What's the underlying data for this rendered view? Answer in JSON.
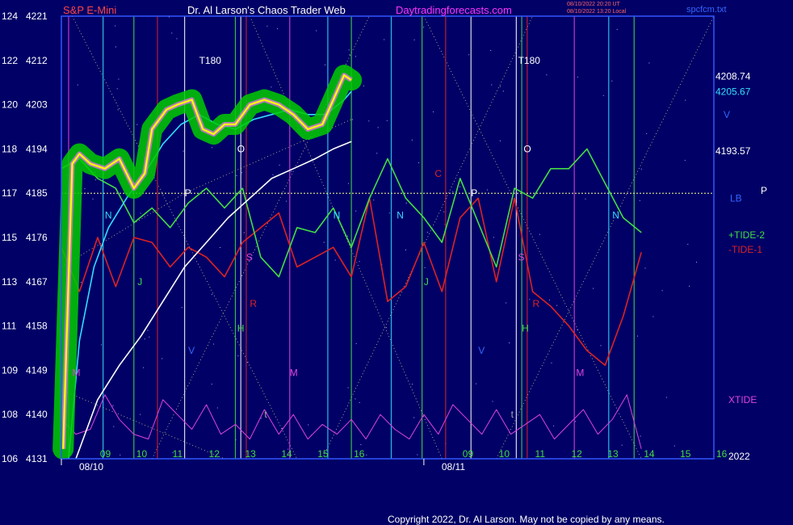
{
  "header": {
    "instrument": "S&P E-Mini",
    "author": "Dr. Al Larson's Chaos Trader Web",
    "site": "Daytradingforecasts.com",
    "timestamp_1": "08/10/2022 20:20 UT",
    "timestamp_2": "08/10/2022 13:20 Local",
    "filename": "spcfcm.txt"
  },
  "footer": {
    "copyright": "Copyright 2022, Dr. Al Larson. May not be copied by any means."
  },
  "colors": {
    "background": "#000066",
    "plot_border": "#3355ff",
    "price": "#ffff00",
    "price_halo": "#00cc00",
    "price_inner": "#ff66ff",
    "avg_fast": "#33ddff",
    "avg_slow": "#ffffff",
    "tide_2": "#44dd44",
    "tide_1": "#dd2222",
    "xtide": "#dd44dd",
    "blue_line": "#2233ee"
  },
  "chart_data": {
    "type": "line",
    "x_axis": {
      "days": [
        {
          "label": "08/10",
          "x": 0
        },
        {
          "label": "08/11",
          "x": 10
        }
      ],
      "hours": [
        {
          "label": "09",
          "x": 1
        },
        {
          "label": "10",
          "x": 2
        },
        {
          "label": "11",
          "x": 3
        },
        {
          "label": "12",
          "x": 4
        },
        {
          "label": "13",
          "x": 5
        },
        {
          "label": "14",
          "x": 6
        },
        {
          "label": "15",
          "x": 7
        },
        {
          "label": "16",
          "x": 8
        },
        {
          "label": "09",
          "x": 11
        },
        {
          "label": "10",
          "x": 12
        },
        {
          "label": "11",
          "x": 13
        },
        {
          "label": "12",
          "x": 14
        },
        {
          "label": "13",
          "x": 15
        },
        {
          "label": "14",
          "x": 16
        },
        {
          "label": "15",
          "x": 17
        },
        {
          "label": "16",
          "x": 18
        }
      ],
      "xlim": [
        0,
        18
      ]
    },
    "y_axis": {
      "ticks": [
        {
          "left": "106",
          "right": "4131",
          "y": 4131
        },
        {
          "left": "108",
          "right": "4140",
          "y": 4140
        },
        {
          "left": "109",
          "right": "4149",
          "y": 4149
        },
        {
          "left": "111",
          "right": "4158",
          "y": 4158
        },
        {
          "left": "113",
          "right": "4167",
          "y": 4167
        },
        {
          "left": "115",
          "right": "4176",
          "y": 4176
        },
        {
          "left": "117",
          "right": "4185",
          "y": 4185
        },
        {
          "left": "118",
          "right": "4194",
          "y": 4194
        },
        {
          "left": "120",
          "right": "4203",
          "y": 4203
        },
        {
          "left": "122",
          "right": "4212",
          "y": 4212
        },
        {
          "left": "124",
          "right": "4221",
          "y": 4221
        }
      ],
      "ylim": [
        4131,
        4221
      ]
    },
    "right_labels": [
      {
        "text": "4208.74",
        "y": 4208.74,
        "color": "#ffffff"
      },
      {
        "text": "4205.67",
        "y": 4205.67,
        "color": "#33ddff"
      },
      {
        "text": "4193.57",
        "y": 4193.57,
        "color": "#ffffff"
      }
    ],
    "right_legend": [
      {
        "text": "V",
        "y": 4201,
        "color": "#3366ff"
      },
      {
        "text": "LB",
        "y": 4184,
        "color": "#3366ff"
      },
      {
        "text": "P",
        "y": 4185.5,
        "color": "#ffffff",
        "offset": 1
      },
      {
        "text": "+TIDE-2",
        "y": 4176.5,
        "color": "#44dd44"
      },
      {
        "text": "-TIDE-1",
        "y": 4173.5,
        "color": "#dd2222"
      },
      {
        "text": "XTIDE",
        "y": 4143,
        "color": "#dd44dd"
      },
      {
        "text": "2022",
        "y": 4131.5,
        "color": "#ffffff"
      }
    ],
    "markers": [
      {
        "text": "T180",
        "x": 3.8,
        "y": 4212,
        "color": "#ffffff"
      },
      {
        "text": "T180",
        "x": 12.6,
        "y": 4212,
        "color": "#ffffff"
      },
      {
        "text": "O",
        "x": 4.85,
        "y": 4194,
        "color": "#ffffff"
      },
      {
        "text": "O",
        "x": 12.75,
        "y": 4194,
        "color": "#ffffff"
      },
      {
        "text": "P",
        "x": 3.4,
        "y": 4185,
        "color": "#ffffff"
      },
      {
        "text": "P",
        "x": 11.3,
        "y": 4185,
        "color": "#ffffff"
      },
      {
        "text": "N",
        "x": 1.2,
        "y": 4180.5,
        "color": "#33ddff"
      },
      {
        "text": "N",
        "x": 7.5,
        "y": 4180.5,
        "color": "#33ddff"
      },
      {
        "text": "N",
        "x": 9.25,
        "y": 4180.5,
        "color": "#33ddff"
      },
      {
        "text": "N",
        "x": 15.2,
        "y": 4180.5,
        "color": "#33ddff"
      },
      {
        "text": "C",
        "x": 10.3,
        "y": 4189,
        "color": "#dd2222"
      },
      {
        "text": "S",
        "x": 5.1,
        "y": 4172,
        "color": "#dd44dd"
      },
      {
        "text": "S",
        "x": 12.6,
        "y": 4172,
        "color": "#dd44dd"
      },
      {
        "text": "J",
        "x": 2.1,
        "y": 4167,
        "color": "#44dd44"
      },
      {
        "text": "J",
        "x": 10,
        "y": 4167,
        "color": "#44dd44"
      },
      {
        "text": "R",
        "x": 5.2,
        "y": 4162.5,
        "color": "#dd2222"
      },
      {
        "text": "R",
        "x": 13,
        "y": 4162.5,
        "color": "#dd2222"
      },
      {
        "text": "H",
        "x": 4.85,
        "y": 4157.5,
        "color": "#44dd44"
      },
      {
        "text": "H",
        "x": 12.7,
        "y": 4157.5,
        "color": "#44dd44"
      },
      {
        "text": "V",
        "x": 3.5,
        "y": 4153,
        "color": "#3366ff"
      },
      {
        "text": "V",
        "x": 11.5,
        "y": 4153,
        "color": "#3366ff"
      },
      {
        "text": "M",
        "x": 0.3,
        "y": 4148.5,
        "color": "#dd44dd"
      },
      {
        "text": "M",
        "x": 6.3,
        "y": 4148.5,
        "color": "#dd44dd"
      },
      {
        "text": "M",
        "x": 14.2,
        "y": 4148.5,
        "color": "#dd44dd"
      },
      {
        "text": "t",
        "x": 5.6,
        "y": 4140,
        "color": "#aaaaaa"
      },
      {
        "text": "t",
        "x": 12.4,
        "y": 4140,
        "color": "#aaaaaa"
      }
    ],
    "vertical_lines": [
      {
        "x": 0.2,
        "color": "#dd44dd"
      },
      {
        "x": 1.15,
        "color": "#33ddff"
      },
      {
        "x": 2.0,
        "color": "#44dd44"
      },
      {
        "x": 2.65,
        "color": "#dd2222"
      },
      {
        "x": 3.4,
        "color": "#ffffff"
      },
      {
        "x": 4.8,
        "color": "#44dd44"
      },
      {
        "x": 4.95,
        "color": "#ffffff"
      },
      {
        "x": 5.1,
        "color": "#dd2222"
      },
      {
        "x": 6.3,
        "color": "#dd44dd"
      },
      {
        "x": 7.35,
        "color": "#33ddff"
      },
      {
        "x": 8.0,
        "color": "#44dd44"
      },
      {
        "x": 9.1,
        "color": "#33ddff"
      },
      {
        "x": 9.95,
        "color": "#44dd44"
      },
      {
        "x": 10.6,
        "color": "#dd2222"
      },
      {
        "x": 11.3,
        "color": "#ffffff"
      },
      {
        "x": 12.55,
        "color": "#ffffff"
      },
      {
        "x": 12.7,
        "color": "#44dd44"
      },
      {
        "x": 12.85,
        "color": "#dd2222"
      },
      {
        "x": 14.15,
        "color": "#dd44dd"
      },
      {
        "x": 15.1,
        "color": "#33ddff"
      },
      {
        "x": 15.8,
        "color": "#44dd44"
      }
    ],
    "horizontal_lines": [
      {
        "y": 4185,
        "color": "#ffff88",
        "dashed": true
      }
    ],
    "series": [
      {
        "name": "S&P E-Mini",
        "color": "#ffff00",
        "x": [
          0.05,
          0.2,
          0.3,
          0.5,
          0.8,
          1.2,
          1.6,
          2.0,
          2.3,
          2.5,
          2.9,
          3.2,
          3.6,
          3.9,
          4.2,
          4.5,
          4.8,
          5.2,
          5.6,
          6.0,
          6.4,
          6.8,
          7.2,
          7.5,
          7.8,
          8.0
        ],
        "y": [
          4133,
          4168,
          4191,
          4193,
          4191,
          4190,
          4192,
          4186,
          4189,
          4198,
          4202,
          4203,
          4204,
          4198,
          4197,
          4199,
          4199,
          4203,
          4204,
          4203,
          4201,
          4198,
          4199,
          4204,
          4209,
          4208
        ]
      },
      {
        "name": "fast average",
        "color": "#33ddff",
        "x": [
          0.2,
          0.5,
          0.9,
          1.3,
          1.8,
          2.3,
          2.8,
          3.3,
          3.8,
          4.3,
          4.8,
          5.3,
          5.8,
          6.3,
          6.8,
          7.3,
          7.8,
          8.0
        ],
        "y": [
          4131,
          4155,
          4170,
          4178,
          4184,
          4189,
          4195,
          4199,
          4201,
          4199,
          4198,
          4200,
          4201,
          4202,
          4201,
          4201,
          4204,
          4205.7
        ]
      },
      {
        "name": "slow average",
        "color": "#ffffff",
        "x": [
          0.4,
          1.0,
          1.6,
          2.2,
          2.8,
          3.4,
          4.0,
          4.6,
          5.2,
          5.8,
          6.4,
          7.0,
          7.5,
          8.0
        ],
        "y": [
          4131,
          4143,
          4150,
          4156,
          4163,
          4170,
          4175,
          4180,
          4184,
          4188,
          4190,
          4192,
          4194,
          4195.5
        ]
      },
      {
        "name": "+TIDE-2",
        "color": "#44dd44",
        "x": [
          0,
          0.5,
          1,
          1.5,
          2,
          2.5,
          3,
          3.5,
          4,
          4.5,
          5,
          5.5,
          6,
          6.5,
          7,
          7.5,
          8,
          8.5,
          9,
          9.5,
          10,
          10.5,
          11,
          11.5,
          12,
          12.5,
          13,
          13.5,
          14,
          14.5,
          15,
          15.5,
          16
        ],
        "y": [
          4190,
          4192,
          4188,
          4186,
          4179,
          4182,
          4178,
          4183,
          4186,
          4182,
          4186,
          4172,
          4168,
          4178,
          4177,
          4182,
          4174,
          4184,
          4192,
          4184,
          4180,
          4175,
          4188,
          4179,
          4170,
          4186,
          4184,
          4190,
          4190,
          4194,
          4187,
          4180,
          4177
        ]
      },
      {
        "name": "-TIDE-1",
        "color": "#dd2222",
        "x": [
          0,
          0.5,
          1,
          1.5,
          2,
          2.5,
          3,
          3.5,
          4,
          4.5,
          5,
          5.5,
          6,
          6.5,
          7,
          7.5,
          8,
          8.5,
          9,
          9.5,
          10,
          10.5,
          11,
          11.5,
          12,
          12.5,
          13,
          13.5,
          14,
          14.5,
          15,
          15.5,
          16
        ],
        "y": [
          4174,
          4165,
          4176,
          4166,
          4176,
          4175,
          4170,
          4174,
          4172,
          4168,
          4175,
          4178,
          4181,
          4170,
          4172,
          4174,
          4168,
          4184,
          4163,
          4166,
          4175,
          4165,
          4180,
          4184,
          4167,
          4184,
          4165,
          4162,
          4158,
          4153,
          4150,
          4160,
          4173
        ]
      },
      {
        "name": "XTIDE",
        "color": "#dd44dd",
        "x": [
          0,
          0.4,
          0.8,
          1.2,
          1.6,
          2.0,
          2.4,
          2.8,
          3.2,
          3.6,
          4.0,
          4.4,
          4.8,
          5.2,
          5.6,
          6.0,
          6.4,
          6.8,
          7.2,
          7.6,
          8.0,
          8.4,
          8.8,
          9.2,
          9.6,
          10.0,
          10.4,
          10.8,
          11.2,
          11.6,
          12.0,
          12.4,
          12.8,
          13.2,
          13.6,
          14.0,
          14.4,
          14.8,
          15.2,
          15.6,
          16.0
        ],
        "y": [
          4139,
          4136,
          4137,
          4144,
          4139,
          4136,
          4135,
          4143,
          4140,
          4137,
          4142,
          4136,
          4138,
          4135,
          4141,
          4136,
          4140,
          4135,
          4138,
          4136,
          4139,
          4135,
          4140,
          4137,
          4135,
          4140,
          4136,
          4142,
          4139,
          4136,
          4141,
          4136,
          4138,
          4140,
          4135,
          4138,
          4141,
          4136,
          4139,
          4144,
          4133
        ]
      }
    ]
  }
}
